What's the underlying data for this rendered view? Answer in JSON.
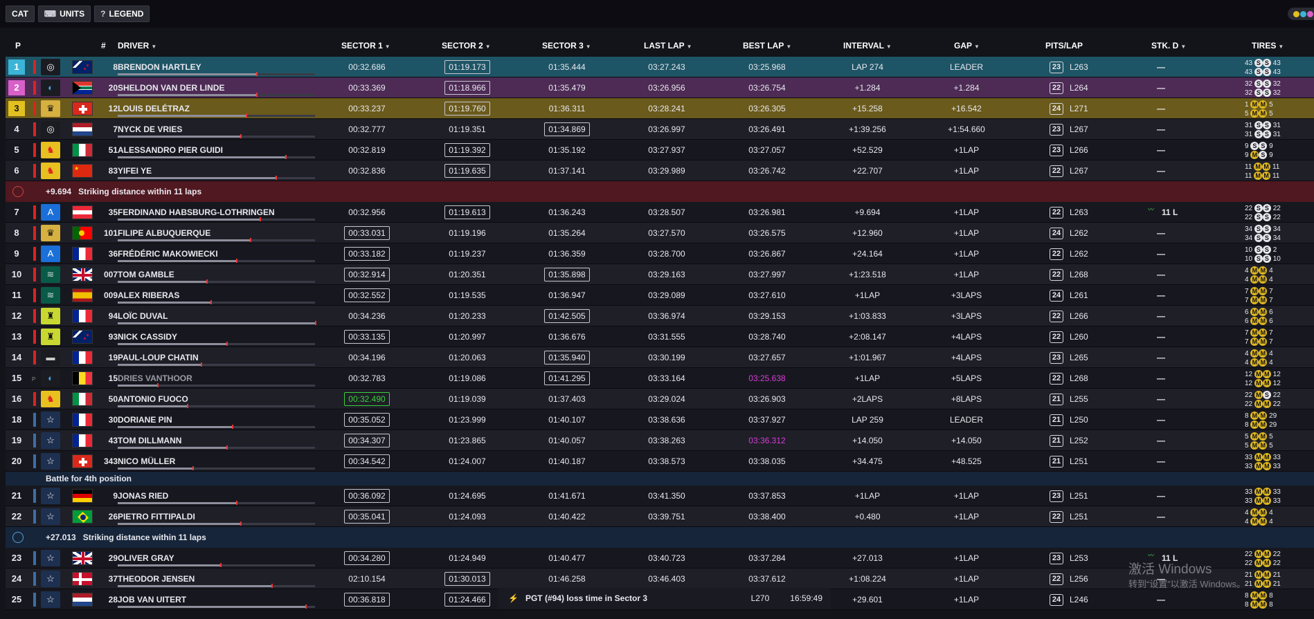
{
  "toolbar": {
    "cat": "CAT",
    "units": "UNITS",
    "legend": "LEGEND",
    "legend_icon": "?"
  },
  "headers": {
    "p": "P",
    "num": "#",
    "driver": "DRIVER",
    "s1": "SECTOR 1",
    "s2": "SECTOR 2",
    "s3": "SECTOR 3",
    "last": "LAST LAP",
    "best": "BEST LAP",
    "interval": "INTERVAL",
    "gap": "GAP",
    "pits": "PITS/LAP",
    "stk": "STK. D",
    "tires": "TIRES"
  },
  "colors": {
    "accent_p1": "#3cb4d8",
    "accent_p2": "#d860c8",
    "accent_p3": "#e2c020",
    "best_sector": "#3bd23b",
    "best_lap": "#d83cd8"
  },
  "rows": [
    {
      "pos": "1",
      "num": "8",
      "driver": "BRENDON HARTLEY",
      "s1": "00:32.686",
      "s2": "01:19.173",
      "s3": "01:35.444",
      "last": "03:27.243",
      "best": "03:25.968",
      "interval": "LAP 274",
      "gap": "LEADER",
      "pits": "23",
      "lap": "L263",
      "stk": "—",
      "t1": [
        "43",
        "S",
        "S",
        "43"
      ],
      "t2": [
        "43",
        "S",
        "S",
        "43"
      ],
      "stripe": "#d22",
      "logo": "toyota-logo-icon",
      "flag": "nz"
    },
    {
      "pos": "2",
      "num": "20",
      "driver": "SHELDON VAN DER LINDE",
      "s1": "00:33.369",
      "s2": "01:18.966",
      "s3": "01:35.479",
      "last": "03:26.956",
      "best": "03:26.754",
      "interval": "+1.284",
      "gap": "+1.284",
      "pits": "22",
      "lap": "L264",
      "stk": "—",
      "t1": [
        "32",
        "S",
        "S",
        "32"
      ],
      "t2": [
        "32",
        "S",
        "S",
        "32"
      ],
      "stripe": "#d22",
      "logo": "bmw-logo-icon",
      "flag": "za"
    },
    {
      "pos": "3",
      "num": "12",
      "driver": "LOUIS DELÉTRAZ",
      "s1": "00:33.237",
      "s2": "01:19.760",
      "s3": "01:36.311",
      "last": "03:28.241",
      "best": "03:26.305",
      "interval": "+15.258",
      "gap": "+16.542",
      "pits": "24",
      "lap": "L271",
      "stk": "—",
      "t1": [
        "1",
        "M",
        "M",
        "5"
      ],
      "t2": [
        "5",
        "M",
        "M",
        "5"
      ],
      "stripe": "#d22",
      "logo": "cadillac-logo-icon",
      "flag": "ch"
    },
    {
      "pos": "4",
      "num": "7",
      "driver": "NYCK DE VRIES",
      "s1": "00:32.777",
      "s2": "01:19.351",
      "s3": "01:34.869",
      "last": "03:26.997",
      "best": "03:26.491",
      "interval": "+1:39.256",
      "gap": "+1:54.660",
      "pits": "23",
      "lap": "L267",
      "stk": "—",
      "t1": [
        "31",
        "S",
        "S",
        "31"
      ],
      "t2": [
        "31",
        "S",
        "S",
        "31"
      ],
      "stripe": "#d22",
      "logo": "toyota-logo-icon",
      "flag": "nl"
    },
    {
      "pos": "5",
      "num": "51",
      "driver": "ALESSANDRO PIER GUIDI",
      "s1": "00:32.819",
      "s2": "01:19.392",
      "s3": "01:35.192",
      "last": "03:27.937",
      "best": "03:27.057",
      "interval": "+52.529",
      "gap": "+1LAP",
      "pits": "23",
      "lap": "L266",
      "stk": "—",
      "t1": [
        "9",
        "S",
        "S",
        "9"
      ],
      "t2": [
        "9",
        "M",
        "S",
        "9"
      ],
      "stripe": "#d22",
      "logo": "ferrari-logo-icon",
      "flag": "it"
    },
    {
      "pos": "6",
      "num": "83",
      "driver": "YIFEI YE",
      "s1": "00:32.836",
      "s2": "01:19.635",
      "s3": "01:37.141",
      "last": "03:29.989",
      "best": "03:26.742",
      "interval": "+22.707",
      "gap": "+1LAP",
      "pits": "22",
      "lap": "L267",
      "stk": "—",
      "t1": [
        "11",
        "M",
        "M",
        "11"
      ],
      "t2": [
        "11",
        "M",
        "M",
        "11"
      ],
      "stripe": "#d22",
      "logo": "ferrari-logo-icon",
      "flag": "cn"
    }
  ],
  "banner1": {
    "value": "+9.694",
    "text": "Striking distance within 11 laps"
  },
  "rows2": [
    {
      "pos": "7",
      "num": "35",
      "driver": "FERDINAND HABSBURG-LOTHRINGEN",
      "s1": "00:32.956",
      "s2": "01:19.613",
      "s3": "01:36.243",
      "last": "03:28.507",
      "best": "03:26.981",
      "interval": "+9.694",
      "gap": "+1LAP",
      "pits": "22",
      "lap": "L263",
      "stk": "11 L",
      "t1": [
        "22",
        "S",
        "S",
        "22"
      ],
      "t2": [
        "22",
        "S",
        "S",
        "22"
      ],
      "stripe": "#d22",
      "logo": "alpine-logo-icon",
      "flag": "at"
    },
    {
      "pos": "8",
      "num": "101",
      "driver": "FILIPE ALBUQUERQUE",
      "s1": "00:33.031",
      "s2": "01:19.196",
      "s3": "01:35.264",
      "last": "03:27.570",
      "best": "03:26.575",
      "interval": "+12.960",
      "gap": "+1LAP",
      "pits": "24",
      "lap": "L262",
      "stk": "—",
      "t1": [
        "34",
        "S",
        "S",
        "34"
      ],
      "t2": [
        "34",
        "S",
        "S",
        "34"
      ],
      "stripe": "#d22",
      "logo": "cadillac-logo-icon",
      "flag": "pt"
    },
    {
      "pos": "9",
      "num": "36",
      "driver": "FRÉDÉRIC MAKOWIECKI",
      "s1": "00:33.182",
      "s2": "01:19.237",
      "s3": "01:36.359",
      "last": "03:28.700",
      "best": "03:26.867",
      "interval": "+24.164",
      "gap": "+1LAP",
      "pits": "22",
      "lap": "L262",
      "stk": "—",
      "t1": [
        "10",
        "S",
        "S",
        "2"
      ],
      "t2": [
        "10",
        "S",
        "S",
        "10"
      ],
      "stripe": "#d22",
      "logo": "alpine-logo-icon",
      "flag": "fr"
    },
    {
      "pos": "10",
      "num": "007",
      "driver": "TOM GAMBLE",
      "s1": "00:32.914",
      "s2": "01:20.351",
      "s3": "01:35.898",
      "last": "03:29.163",
      "best": "03:27.997",
      "interval": "+1:23.518",
      "gap": "+1LAP",
      "pits": "22",
      "lap": "L268",
      "stk": "—",
      "t1": [
        "4",
        "M",
        "M",
        "4"
      ],
      "t2": [
        "4",
        "M",
        "M",
        "4"
      ],
      "stripe": "#d22",
      "logo": "aston-martin-logo-icon",
      "flag": "gb"
    },
    {
      "pos": "11",
      "num": "009",
      "driver": "ALEX RIBERAS",
      "s1": "00:32.552",
      "s2": "01:19.535",
      "s3": "01:36.947",
      "last": "03:29.089",
      "best": "03:27.610",
      "interval": "+1LAP",
      "gap": "+3LAPS",
      "pits": "24",
      "lap": "L261",
      "stk": "—",
      "t1": [
        "7",
        "M",
        "M",
        "7"
      ],
      "t2": [
        "7",
        "M",
        "M",
        "7"
      ],
      "stripe": "#d22",
      "logo": "aston-martin-logo-icon",
      "flag": "es"
    },
    {
      "pos": "12",
      "num": "94",
      "driver": "LOÏC DUVAL",
      "s1": "00:34.236",
      "s2": "01:20.233",
      "s3": "01:42.505",
      "last": "03:36.974",
      "best": "03:29.153",
      "interval": "+1:03.833",
      "gap": "+3LAPS",
      "pits": "22",
      "lap": "L266",
      "stk": "—",
      "t1": [
        "6",
        "M",
        "M",
        "6"
      ],
      "t2": [
        "6",
        "M",
        "M",
        "6"
      ],
      "stripe": "#d22",
      "logo": "peugeot-logo-icon",
      "flag": "fr"
    },
    {
      "pos": "13",
      "num": "93",
      "driver": "NICK CASSIDY",
      "s1": "00:33.135",
      "s2": "01:20.997",
      "s3": "01:36.676",
      "last": "03:31.555",
      "best": "03:28.740",
      "interval": "+2:08.147",
      "gap": "+4LAPS",
      "pits": "22",
      "lap": "L260",
      "stk": "—",
      "t1": [
        "7",
        "M",
        "M",
        "7"
      ],
      "t2": [
        "7",
        "M",
        "M",
        "7"
      ],
      "stripe": "#d22",
      "logo": "peugeot-logo-icon",
      "flag": "nz"
    },
    {
      "pos": "14",
      "num": "19",
      "driver": "PAUL-LOUP CHATIN",
      "s1": "00:34.196",
      "s2": "01:20.063",
      "s3": "01:35.940",
      "last": "03:30.199",
      "best": "03:27.657",
      "interval": "+1:01.967",
      "gap": "+4LAPS",
      "pits": "23",
      "lap": "L265",
      "stk": "—",
      "t1": [
        "4",
        "M",
        "M",
        "4"
      ],
      "t2": [
        "4",
        "M",
        "M",
        "4"
      ],
      "stripe": "#d22",
      "logo": "lamborghini-logo-icon",
      "flag": "fr"
    },
    {
      "pos": "15",
      "num": "15",
      "driver": "DRIES VANTHOOR",
      "s1": "00:32.783",
      "s2": "01:19.086",
      "s3": "01:41.295",
      "last": "03:33.164",
      "best": "03:25.638",
      "interval": "+1LAP",
      "gap": "+5LAPS",
      "pits": "22",
      "lap": "L268",
      "stk": "—",
      "t1": [
        "12",
        "M",
        "M",
        "12"
      ],
      "t2": [
        "12",
        "M",
        "M",
        "12"
      ],
      "stripe": "#d22",
      "logo": "bmw-logo-icon",
      "flag": "be",
      "pit": "P"
    },
    {
      "pos": "16",
      "num": "50",
      "driver": "ANTONIO FUOCO",
      "s1": "00:32.490",
      "s2": "01:19.039",
      "s3": "01:37.403",
      "last": "03:29.024",
      "best": "03:26.903",
      "interval": "+2LAPS",
      "gap": "+8LAPS",
      "pits": "21",
      "lap": "L255",
      "stk": "—",
      "t1": [
        "22",
        "M",
        "S",
        "22"
      ],
      "t2": [
        "22",
        "M",
        "M",
        "22"
      ],
      "stripe": "#d22",
      "logo": "ferrari-logo-icon",
      "flag": "it"
    },
    {
      "pos": "18",
      "num": "30",
      "driver": "DORIANE PIN",
      "s1": "00:35.052",
      "s2": "01:23.999",
      "s3": "01:40.107",
      "last": "03:38.636",
      "best": "03:37.927",
      "interval": "LAP 259",
      "gap": "LEADER",
      "pits": "21",
      "lap": "L250",
      "stk": "—",
      "t1": [
        "8",
        "M",
        "M",
        "29"
      ],
      "t2": [
        "8",
        "M",
        "M",
        "29"
      ],
      "stripe": "#3a6ea8",
      "logo": "star-logo-icon",
      "flag": "fr"
    },
    {
      "pos": "19",
      "num": "43",
      "driver": "TOM DILLMANN",
      "s1": "00:34.307",
      "s2": "01:23.865",
      "s3": "01:40.057",
      "last": "03:38.263",
      "best": "03:36.312",
      "interval": "+14.050",
      "gap": "+14.050",
      "pits": "21",
      "lap": "L252",
      "stk": "—",
      "t1": [
        "5",
        "M",
        "M",
        "5"
      ],
      "t2": [
        "5",
        "M",
        "M",
        "5"
      ],
      "stripe": "#3a6ea8",
      "logo": "star-logo-icon",
      "flag": "fr"
    },
    {
      "pos": "20",
      "num": "343",
      "driver": "NICO MÜLLER",
      "s1": "00:34.542",
      "s2": "01:24.007",
      "s3": "01:40.187",
      "last": "03:38.573",
      "best": "03:38.035",
      "interval": "+34.475",
      "gap": "+48.525",
      "pits": "21",
      "lap": "L251",
      "stk": "—",
      "t1": [
        "33",
        "M",
        "M",
        "33"
      ],
      "t2": [
        "33",
        "M",
        "M",
        "33"
      ],
      "stripe": "#3a6ea8",
      "logo": "star-logo-icon",
      "flag": "ch"
    }
  ],
  "banner2": {
    "text": "Battle for 4th position"
  },
  "rows3": [
    {
      "pos": "21",
      "num": "9",
      "driver": "JONAS RIED",
      "s1": "00:36.092",
      "s2": "01:24.695",
      "s3": "01:41.671",
      "last": "03:41.350",
      "best": "03:37.853",
      "interval": "+1LAP",
      "gap": "+1LAP",
      "pits": "23",
      "lap": "L251",
      "stk": "—",
      "t1": [
        "33",
        "M",
        "M",
        "33"
      ],
      "t2": [
        "33",
        "M",
        "M",
        "33"
      ],
      "stripe": "#3a6ea8",
      "logo": "star-logo-icon",
      "flag": "de"
    },
    {
      "pos": "22",
      "num": "26",
      "driver": "PIETRO FITTIPALDI",
      "s1": "00:35.041",
      "s2": "01:24.093",
      "s3": "01:40.422",
      "last": "03:39.751",
      "best": "03:38.400",
      "interval": "+0.480",
      "gap": "+1LAP",
      "pits": "22",
      "lap": "L251",
      "stk": "—",
      "t1": [
        "4",
        "M",
        "M",
        "4"
      ],
      "t2": [
        "4",
        "M",
        "M",
        "4"
      ],
      "stripe": "#3a6ea8",
      "logo": "star-logo-icon",
      "flag": "br"
    }
  ],
  "banner3": {
    "value": "+27.013",
    "text": "Striking distance within 11 laps"
  },
  "rows4": [
    {
      "pos": "23",
      "num": "29",
      "driver": "OLIVER GRAY",
      "s1": "00:34.280",
      "s2": "01:24.949",
      "s3": "01:40.477",
      "last": "03:40.723",
      "best": "03:37.284",
      "interval": "+27.013",
      "gap": "+1LAP",
      "pits": "23",
      "lap": "L253",
      "stk": "11 L",
      "t1": [
        "22",
        "M",
        "M",
        "22"
      ],
      "t2": [
        "22",
        "M",
        "M",
        "22"
      ],
      "stripe": "#3a6ea8",
      "logo": "star-logo-icon",
      "flag": "gb"
    },
    {
      "pos": "24",
      "num": "37",
      "driver": "THEODOR JENSEN",
      "s1": "02:10.154",
      "s2": "01:30.013",
      "s3": "01:46.258",
      "last": "03:46.403",
      "best": "03:37.612",
      "interval": "+1:08.224",
      "gap": "+1LAP",
      "pits": "22",
      "lap": "L256",
      "stk": "—",
      "t1": [
        "21",
        "M",
        "M",
        "21"
      ],
      "t2": [
        "21",
        "M",
        "M",
        "21"
      ],
      "stripe": "#3a6ea8",
      "logo": "star-logo-icon",
      "flag": "dk"
    },
    {
      "pos": "25",
      "num": "28",
      "driver": "JOB VAN UITERT",
      "s1": "00:36.818",
      "s2": "01:24.466",
      "s3": "",
      "last": "",
      "best": "",
      "interval": "+29.601",
      "gap": "+1LAP",
      "pits": "24",
      "lap": "L246",
      "stk": "—",
      "t1": [
        "8",
        "M",
        "M",
        "8"
      ],
      "t2": [
        "8",
        "M",
        "M",
        "8"
      ],
      "stripe": "#3a6ea8",
      "logo": "star-logo-icon",
      "flag": "nl"
    }
  ],
  "toast": {
    "msg": "PGT (#94) loss time in Sector 3",
    "lap": "L270",
    "time": "16:59:49"
  },
  "watermark": {
    "line1": "激活 Windows",
    "line2": "转到“设置”以激活 Windows。"
  }
}
